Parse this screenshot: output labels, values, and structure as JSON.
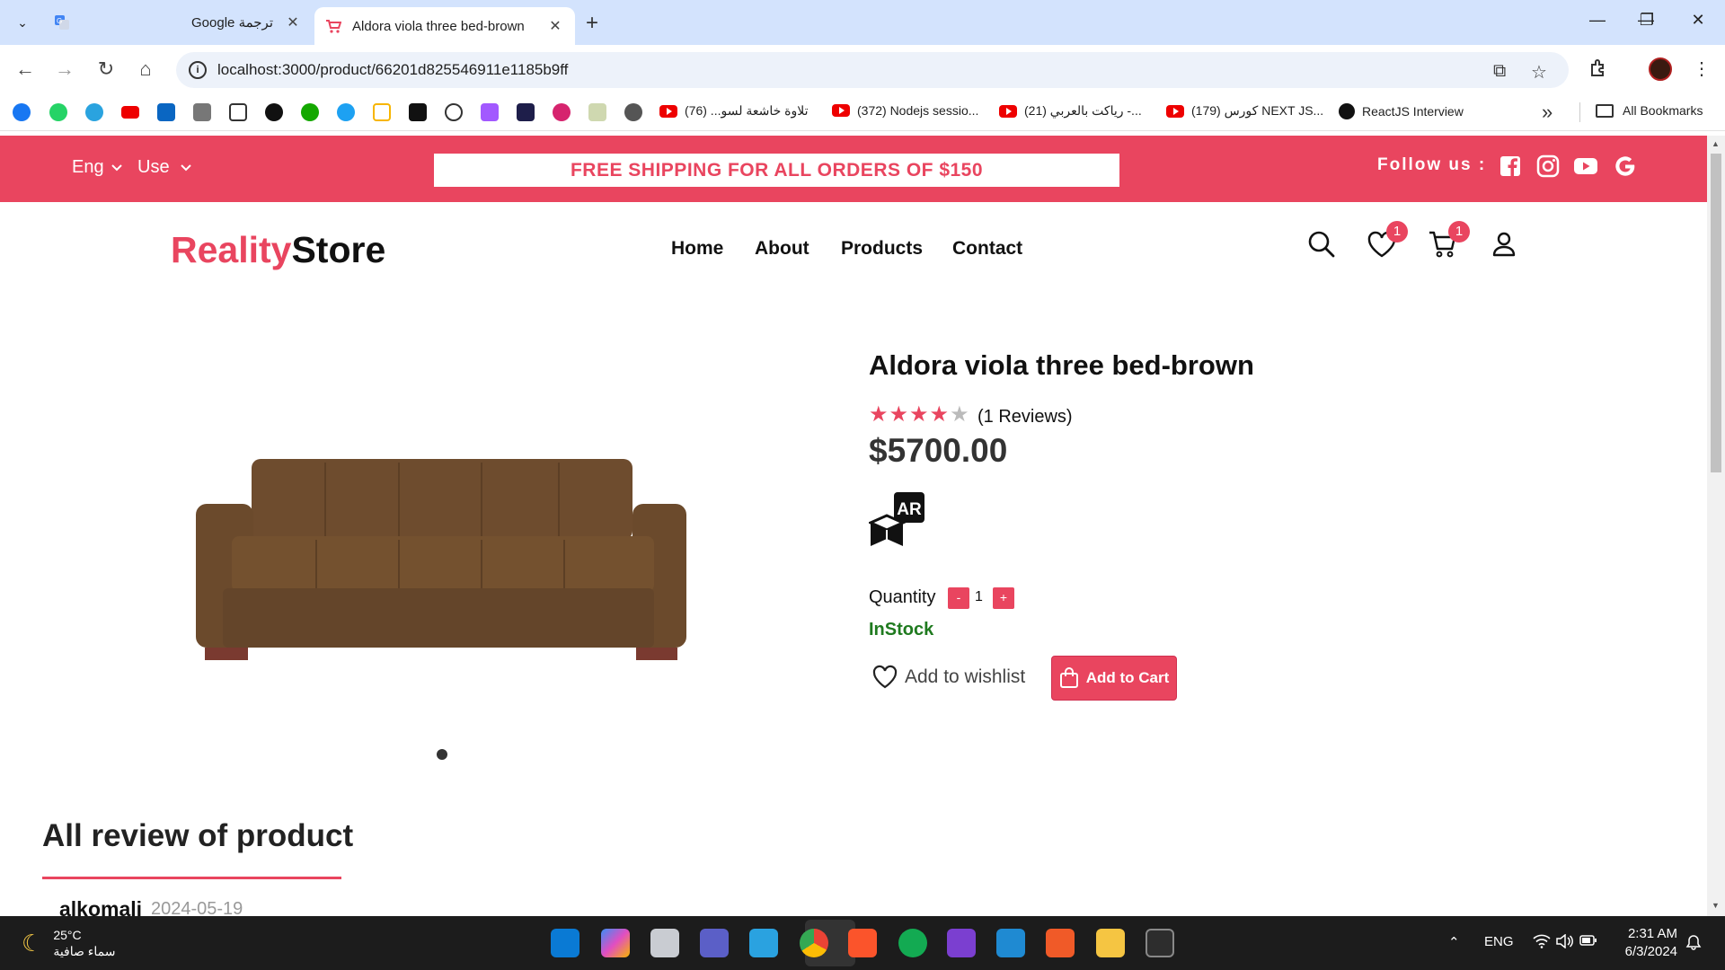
{
  "browser": {
    "tabs": [
      {
        "title": "Google ترجمة",
        "close": "✕"
      },
      {
        "title": "Aldora viola three bed-brown",
        "close": "✕"
      }
    ],
    "new_tab": "+",
    "window_controls": {
      "minimize": "—",
      "restore": "❐",
      "close": "✕"
    },
    "url": "localhost:3000/product/66201d825546911e1185b9ff",
    "bookmarks": [
      {
        "label": "تلاوة خاشعة لسو... (76)",
        "icon": "youtube-icon"
      },
      {
        "label": "(372) Nodejs sessio...",
        "icon": "youtube-icon"
      },
      {
        "label": "(21) رياكت بالعربي -...",
        "icon": "youtube-icon"
      },
      {
        "label": "(179) كورس NEXT JS...",
        "icon": "youtube-icon"
      },
      {
        "label": "ReactJS Interview",
        "icon": "github-icon"
      }
    ],
    "bookmarks_more": "»",
    "all_bookmarks": "All Bookmarks"
  },
  "topbar": {
    "lang_label": "Eng",
    "currency_label": "Use",
    "promo": "FREE SHIPPING FOR ALL ORDERS OF $150",
    "follow_label": "Follow us :",
    "social": [
      "facebook-icon",
      "instagram-icon",
      "youtube-icon",
      "google-icon"
    ],
    "color": "#e9455f"
  },
  "header": {
    "logo_part1": "Reality",
    "logo_part2": "Store",
    "nav": [
      "Home",
      "About",
      "Products",
      "Contact"
    ],
    "wishlist_count": "1",
    "cart_count": "1"
  },
  "product": {
    "title": "Aldora viola three bed-brown",
    "rating": 4,
    "rating_max": 5,
    "reviews_text": "(1 Reviews)",
    "price": "$5700.00",
    "ar_label": "AR",
    "quantity_label": "Quantity",
    "qty_minus": "-",
    "qty_value": "1",
    "qty_plus": "+",
    "stock": "InStock",
    "wishlist_label": "Add to wishlist",
    "add_to_cart": "Add to Cart"
  },
  "reviews_section": {
    "heading": "All review of product",
    "items": [
      {
        "user": "alkomali",
        "date": "2024-05-19"
      }
    ]
  },
  "taskbar": {
    "weather_temp": "25°C",
    "weather_desc": "سماء صافية",
    "lang": "ENG",
    "time": "2:31 AM",
    "date": "6/3/2024"
  }
}
